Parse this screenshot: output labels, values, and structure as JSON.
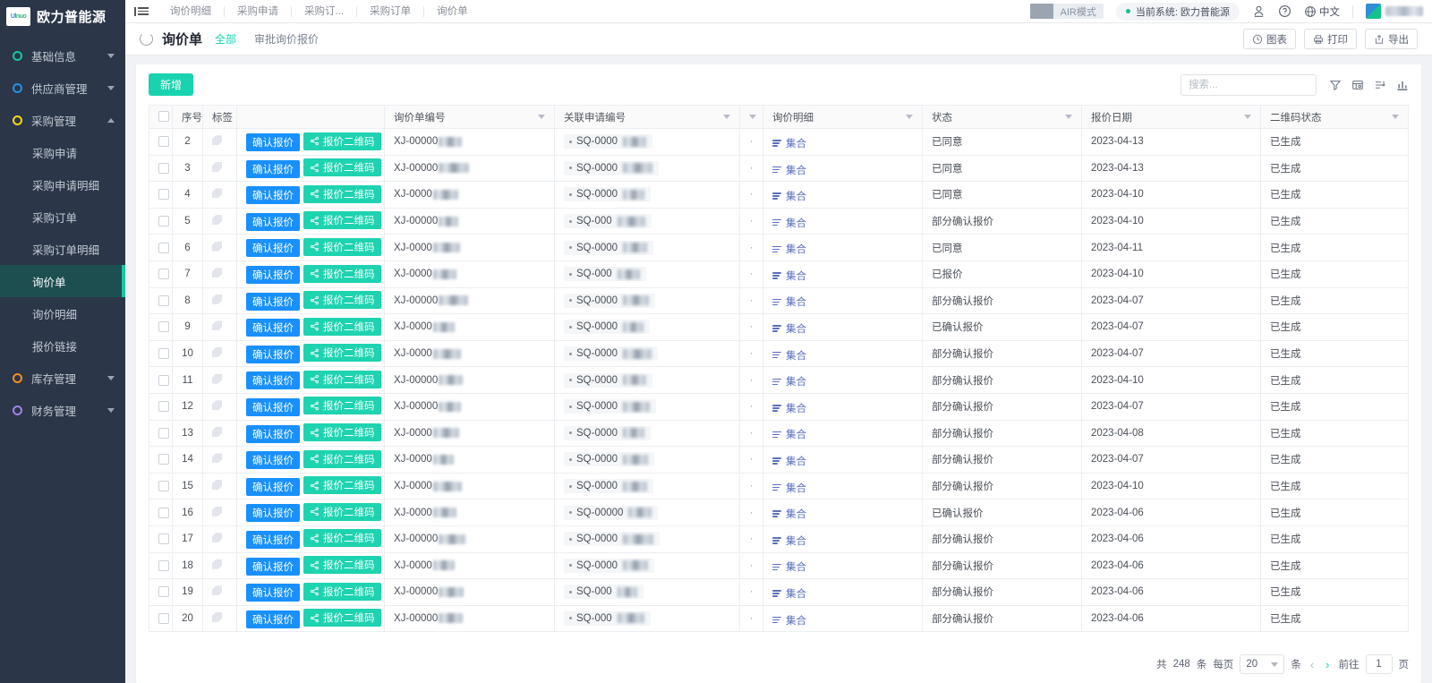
{
  "sidebar": {
    "brand": "欧力普能源",
    "logo_text_1": "Ul",
    "logo_text_2": "nuo",
    "groups": [
      {
        "label": "基础信息",
        "expanded": false
      },
      {
        "label": "供应商管理",
        "expanded": false
      },
      {
        "label": "采购管理",
        "expanded": true
      },
      {
        "label": "库存管理",
        "expanded": false
      },
      {
        "label": "财务管理",
        "expanded": false
      }
    ],
    "sub_items": [
      {
        "label": "采购申请",
        "active": false
      },
      {
        "label": "采购申请明细",
        "active": false
      },
      {
        "label": "采购订单",
        "active": false
      },
      {
        "label": "采购订单明细",
        "active": false
      },
      {
        "label": "询价单",
        "active": true
      },
      {
        "label": "询价明细",
        "active": false
      },
      {
        "label": "报价链接",
        "active": false
      }
    ]
  },
  "topbar": {
    "tabs": [
      "询价明细",
      "采购申请",
      "采购订...",
      "采购订单",
      "询价单"
    ],
    "air_mode_label": "AIR模式",
    "system_label": "当前系统: 欧力普能源",
    "lang_label": "中文"
  },
  "pagehead": {
    "title": "询价单",
    "view_tabs": [
      {
        "label": "全部",
        "active": true
      },
      {
        "label": "审批询价报价",
        "active": false
      }
    ],
    "actions": [
      {
        "label": "图表",
        "icon": "clock-chart-icon"
      },
      {
        "label": "打印",
        "icon": "printer-icon"
      },
      {
        "label": "导出",
        "icon": "export-icon"
      }
    ]
  },
  "toolbar": {
    "new_label": "新增",
    "search_placeholder": "搜索...",
    "search_value": "",
    "icons": [
      "filter-icon",
      "table-settings-icon",
      "sort-icon",
      "bar-chart-icon"
    ]
  },
  "table": {
    "columns": [
      {
        "key": "idx",
        "label": "序号",
        "sortable": false
      },
      {
        "key": "tag",
        "label": "标签",
        "sortable": false
      },
      {
        "key": "actions",
        "label": "",
        "sortable": false
      },
      {
        "key": "xj",
        "label": "询价单编号",
        "sortable": true
      },
      {
        "key": "sq",
        "label": "关联申请编号",
        "sortable": true
      },
      {
        "key": "dot",
        "label": "",
        "sortable": true
      },
      {
        "key": "detail",
        "label": "询价明细",
        "sortable": true
      },
      {
        "key": "status",
        "label": "状态",
        "sortable": true
      },
      {
        "key": "date",
        "label": "报价日期",
        "sortable": true
      },
      {
        "key": "qr",
        "label": "二维码状态",
        "sortable": true
      }
    ],
    "row_buttons": {
      "confirm_label": "确认报价",
      "qrcode_label": "报价二维码"
    },
    "detail_link_label": "集合",
    "xj_prefix": "XJ-00000",
    "sq_prefix": "SQ-0000",
    "rows": [
      {
        "idx": "2",
        "xj": "XJ-00000",
        "sq": "SQ-0000",
        "detail": "集合",
        "status": "已同意",
        "date": "2023-04-13",
        "qr": "已生成"
      },
      {
        "idx": "3",
        "xj": "XJ-00000",
        "sq": "SQ-0000",
        "detail": "集合",
        "status": "已同意",
        "date": "2023-04-13",
        "qr": "已生成"
      },
      {
        "idx": "4",
        "xj": "XJ-0000",
        "sq": "SQ-0000",
        "detail": "集合",
        "status": "已同意",
        "date": "2023-04-10",
        "qr": "已生成"
      },
      {
        "idx": "5",
        "xj": "XJ-00000",
        "sq": "SQ-000",
        "detail": "集合",
        "status": "部分确认报价",
        "date": "2023-04-10",
        "qr": "已生成"
      },
      {
        "idx": "6",
        "xj": "XJ-0000",
        "sq": "SQ-0000",
        "detail": "集合",
        "status": "已同意",
        "date": "2023-04-11",
        "qr": "已生成"
      },
      {
        "idx": "7",
        "xj": "XJ-0000",
        "sq": "SQ-000",
        "detail": "集合",
        "status": "已报价",
        "date": "2023-04-10",
        "qr": "已生成"
      },
      {
        "idx": "8",
        "xj": "XJ-00000",
        "sq": "SQ-0000",
        "detail": "集合",
        "status": "部分确认报价",
        "date": "2023-04-07",
        "qr": "已生成"
      },
      {
        "idx": "9",
        "xj": "XJ-0000",
        "sq": "SQ-0000",
        "detail": "集合",
        "status": "已确认报价",
        "date": "2023-04-07",
        "qr": "已生成"
      },
      {
        "idx": "10",
        "xj": "XJ-0000",
        "sq": "SQ-0000",
        "detail": "集合",
        "status": "部分确认报价",
        "date": "2023-04-07",
        "qr": "已生成"
      },
      {
        "idx": "11",
        "xj": "XJ-00000",
        "sq": "SQ-0000",
        "detail": "集合",
        "status": "部分确认报价",
        "date": "2023-04-10",
        "qr": "已生成"
      },
      {
        "idx": "12",
        "xj": "XJ-00000",
        "sq": "SQ-0000",
        "detail": "集合",
        "status": "部分确认报价",
        "date": "2023-04-07",
        "qr": "已生成"
      },
      {
        "idx": "13",
        "xj": "XJ-0000",
        "sq": "SQ-0000",
        "detail": "集合",
        "status": "部分确认报价",
        "date": "2023-04-08",
        "qr": "已生成"
      },
      {
        "idx": "14",
        "xj": "XJ-0000",
        "sq": "SQ-0000",
        "detail": "集合",
        "status": "部分确认报价",
        "date": "2023-04-07",
        "qr": "已生成"
      },
      {
        "idx": "15",
        "xj": "XJ-0000",
        "sq": "SQ-0000",
        "detail": "集合",
        "status": "部分确认报价",
        "date": "2023-04-10",
        "qr": "已生成"
      },
      {
        "idx": "16",
        "xj": "XJ-0000",
        "sq": "SQ-00000",
        "detail": "集合",
        "status": "已确认报价",
        "date": "2023-04-06",
        "qr": "已生成"
      },
      {
        "idx": "17",
        "xj": "XJ-00000",
        "sq": "SQ-0000",
        "detail": "集合",
        "status": "部分确认报价",
        "date": "2023-04-06",
        "qr": "已生成"
      },
      {
        "idx": "18",
        "xj": "XJ-0000",
        "sq": "SQ-0000",
        "detail": "集合",
        "status": "部分确认报价",
        "date": "2023-04-06",
        "qr": "已生成"
      },
      {
        "idx": "19",
        "xj": "XJ-00000",
        "sq": "SQ-000",
        "detail": "集合",
        "status": "部分确认报价",
        "date": "2023-04-06",
        "qr": "已生成"
      },
      {
        "idx": "20",
        "xj": "XJ-00000",
        "sq": "SQ-000",
        "detail": "集合",
        "status": "部分确认报价",
        "date": "2023-04-06",
        "qr": "已生成"
      }
    ]
  },
  "pagination": {
    "total_prefix": "共",
    "total": "248",
    "total_suffix": "条",
    "per_page_label": "每页",
    "per_page_value": "20",
    "per_page_unit": "条",
    "goto_label": "前往",
    "page_value": "1",
    "page_unit": "页"
  },
  "colors": {
    "sidebar_bg": "#2b3648",
    "accent_teal": "#19d3b0",
    "accent_blue": "#1890ff",
    "active_item_bg": "#1d4f51"
  }
}
